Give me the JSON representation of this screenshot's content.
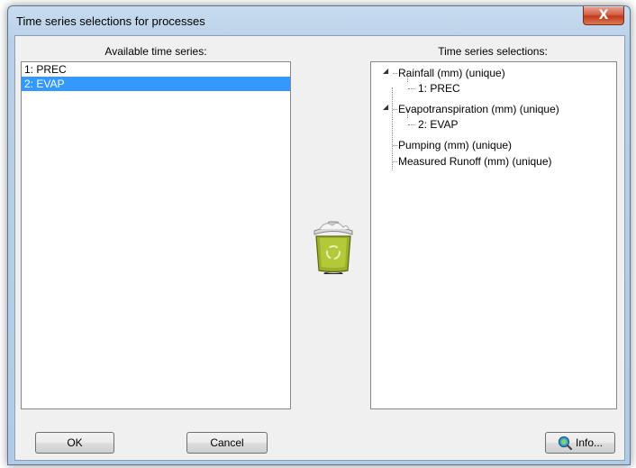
{
  "window": {
    "title": "Time series selections for processes",
    "close_glyph": "X"
  },
  "available": {
    "label": "Available time series:",
    "items": [
      {
        "label": "1:  PREC",
        "selected": false
      },
      {
        "label": "2: EVAP",
        "selected": true
      }
    ]
  },
  "selections": {
    "label": "Time series selections:",
    "tree": [
      {
        "label": "Rainfall (mm) (unique)",
        "children": [
          "1:  PREC"
        ]
      },
      {
        "label": "Evapotranspiration (mm) (unique)",
        "children": [
          "2: EVAP"
        ]
      },
      {
        "label": "Pumping (mm) (unique)",
        "children": []
      },
      {
        "label": "Measured Runoff (mm) (unique)",
        "children": []
      }
    ]
  },
  "icons": {
    "trash": "trash-can-icon",
    "info": "info-magnifier-icon"
  },
  "buttons": {
    "ok": "OK",
    "cancel": "Cancel",
    "info": "Info..."
  },
  "colors": {
    "selection": "#3399ff",
    "close_button": "#c8402a"
  }
}
